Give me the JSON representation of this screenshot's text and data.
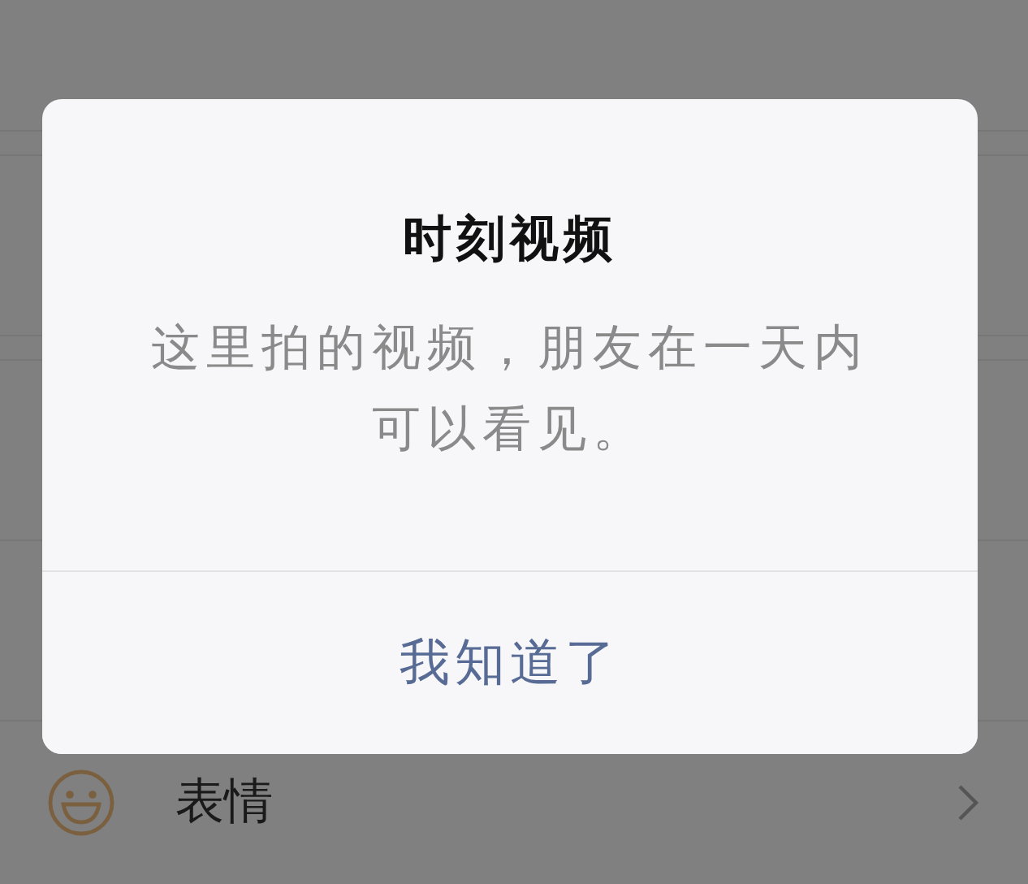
{
  "list": {
    "items": [
      {
        "label": "表情"
      }
    ]
  },
  "dialog": {
    "title": "时刻视频",
    "message": "这里拍的视频，朋友在一天内可以看见。",
    "button": "我知道了"
  }
}
